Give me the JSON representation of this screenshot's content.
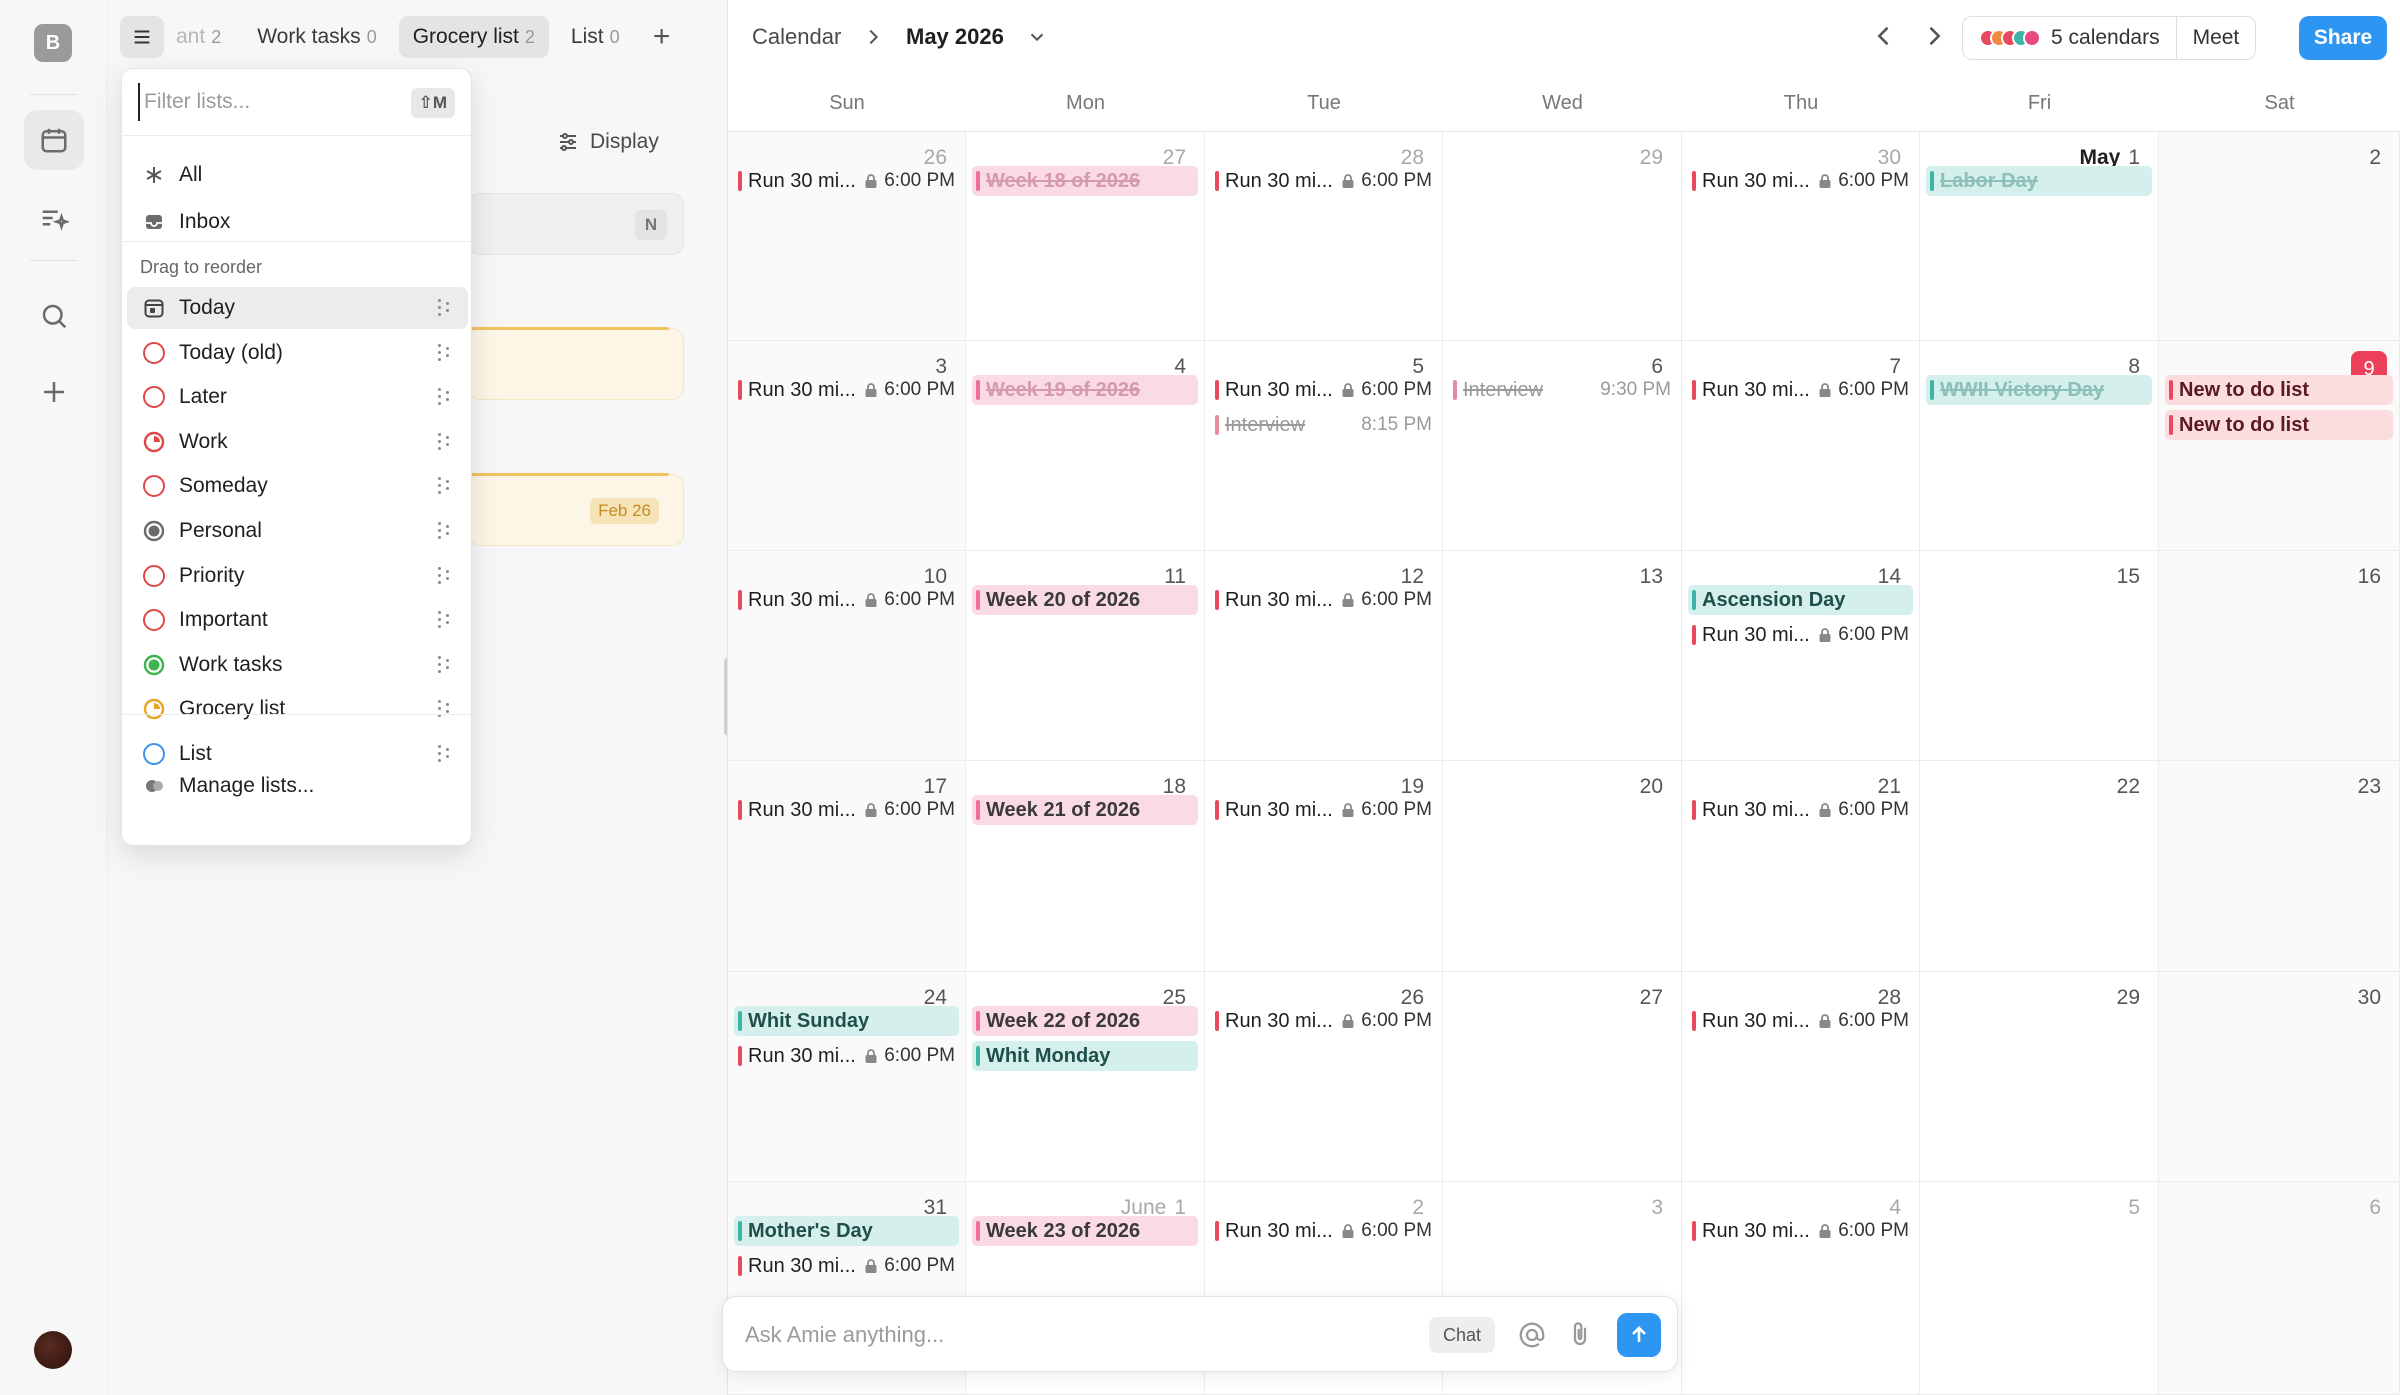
{
  "rail": {
    "workspace_initial": "B",
    "items": [
      {
        "name": "calendar-icon"
      },
      {
        "name": "tasks-sparkle-icon"
      },
      {
        "name": "search-icon"
      },
      {
        "name": "plus-icon"
      }
    ]
  },
  "tabs": [
    {
      "label": "ant",
      "count": "2"
    },
    {
      "label": "Work tasks",
      "count": "0"
    },
    {
      "label": "Grocery list",
      "count": "2"
    },
    {
      "label": "List",
      "count": "0"
    }
  ],
  "panel": {
    "display_label": "Display",
    "card_key": "N",
    "card_date": "Feb 26"
  },
  "dropdown": {
    "filter_placeholder": "Filter lists...",
    "filter_shortcut": "⇧M",
    "top_items": [
      {
        "label": "All",
        "icon": "asterisk-icon"
      },
      {
        "label": "Inbox",
        "icon": "inbox-icon"
      }
    ],
    "section_label": "Drag to reorder",
    "lists": [
      {
        "label": "Today",
        "icon": "today-calendar-icon"
      },
      {
        "label": "Today (old)",
        "icon": "ring-icon",
        "color": "#e04848"
      },
      {
        "label": "Later",
        "icon": "ring-icon",
        "color": "#e04848"
      },
      {
        "label": "Work",
        "icon": "pie-ring-icon",
        "color": "#e04848"
      },
      {
        "label": "Someday",
        "icon": "ring-icon",
        "color": "#e04848"
      },
      {
        "label": "Personal",
        "icon": "filled-ring-icon",
        "color": "#6b6b6b"
      },
      {
        "label": "Priority",
        "icon": "ring-icon",
        "color": "#e04848"
      },
      {
        "label": "Important",
        "icon": "ring-icon",
        "color": "#e04848"
      },
      {
        "label": "Work tasks",
        "icon": "filled-ring-icon",
        "color": "#3fb34f"
      },
      {
        "label": "Grocery list",
        "icon": "pie-ring-icon",
        "color": "#e8a526"
      },
      {
        "label": "List",
        "icon": "ring-icon",
        "color": "#3d94e6"
      }
    ],
    "manage_label": "Manage lists..."
  },
  "calendar": {
    "breadcrumb_root": "Calendar",
    "month_title": "May 2026",
    "calendars_label": "5 calendars",
    "calendar_colors": [
      "#e8495f",
      "#f08a3c",
      "#e8495f",
      "#3db5a6",
      "#e8497f"
    ],
    "meet_label": "Meet",
    "share_label": "Share",
    "weekdays": [
      "Sun",
      "Mon",
      "Tue",
      "Wed",
      "Thu",
      "Fri",
      "Sat"
    ],
    "weeks": [
      [
        {
          "num": "26",
          "muted": true,
          "events": [
            {
              "title": "Run 30 mi...",
              "time": "6:00 PM",
              "lock": true
            }
          ]
        },
        {
          "num": "27",
          "muted": true,
          "events": [
            {
              "title": "Week 18 of 2026",
              "style": "pink",
              "struck": true
            }
          ]
        },
        {
          "num": "28",
          "muted": true,
          "events": [
            {
              "title": "Run 30 mi...",
              "time": "6:00 PM",
              "lock": true
            }
          ]
        },
        {
          "num": "29",
          "muted": true,
          "events": []
        },
        {
          "num": "30",
          "muted": true,
          "events": [
            {
              "title": "Run 30 mi...",
              "time": "6:00 PM",
              "lock": true
            }
          ]
        },
        {
          "num": "1",
          "month": "May",
          "events": [
            {
              "title": "Labor Day",
              "style": "teal",
              "struck": true
            }
          ]
        },
        {
          "num": "2",
          "events": []
        }
      ],
      [
        {
          "num": "3",
          "events": [
            {
              "title": "Run 30 mi...",
              "time": "6:00 PM",
              "lock": true
            }
          ]
        },
        {
          "num": "4",
          "events": [
            {
              "title": "Week 19 of 2026",
              "style": "pink",
              "struck": true
            }
          ]
        },
        {
          "num": "5",
          "events": [
            {
              "title": "Run 30 mi...",
              "time": "6:00 PM",
              "lock": true
            },
            {
              "title": "Interview",
              "time": "8:15 PM",
              "struck": true,
              "style": "grey-bar"
            }
          ]
        },
        {
          "num": "6",
          "events": [
            {
              "title": "Interview",
              "time": "9:30 PM",
              "struck": true,
              "style": "grey-bar"
            }
          ]
        },
        {
          "num": "7",
          "events": [
            {
              "title": "Run 30 mi...",
              "time": "6:00 PM",
              "lock": true
            }
          ]
        },
        {
          "num": "8",
          "events": [
            {
              "title": "WWII Victory Day",
              "style": "teal",
              "struck": true
            }
          ]
        },
        {
          "num": "9",
          "today": true,
          "events": [
            {
              "title": "New to do list",
              "style": "red"
            },
            {
              "title": "New to do list",
              "style": "red"
            }
          ]
        }
      ],
      [
        {
          "num": "10",
          "events": [
            {
              "title": "Run 30 mi...",
              "time": "6:00 PM",
              "lock": true
            }
          ]
        },
        {
          "num": "11",
          "events": [
            {
              "title": "Week 20 of 2026",
              "style": "pink"
            }
          ]
        },
        {
          "num": "12",
          "events": [
            {
              "title": "Run 30 mi...",
              "time": "6:00 PM",
              "lock": true
            }
          ]
        },
        {
          "num": "13",
          "events": []
        },
        {
          "num": "14",
          "events": [
            {
              "title": "Ascension Day",
              "style": "teal"
            },
            {
              "title": "Run 30 mi...",
              "time": "6:00 PM",
              "lock": true
            }
          ]
        },
        {
          "num": "15",
          "events": []
        },
        {
          "num": "16",
          "events": []
        }
      ],
      [
        {
          "num": "17",
          "events": [
            {
              "title": "Run 30 mi...",
              "time": "6:00 PM",
              "lock": true
            }
          ]
        },
        {
          "num": "18",
          "events": [
            {
              "title": "Week 21 of 2026",
              "style": "pink"
            }
          ]
        },
        {
          "num": "19",
          "events": [
            {
              "title": "Run 30 mi...",
              "time": "6:00 PM",
              "lock": true
            }
          ]
        },
        {
          "num": "20",
          "events": []
        },
        {
          "num": "21",
          "events": [
            {
              "title": "Run 30 mi...",
              "time": "6:00 PM",
              "lock": true
            }
          ]
        },
        {
          "num": "22",
          "events": []
        },
        {
          "num": "23",
          "events": []
        }
      ],
      [
        {
          "num": "24",
          "events": [
            {
              "title": "Whit Sunday",
              "style": "teal"
            },
            {
              "title": "Run 30 mi...",
              "time": "6:00 PM",
              "lock": true
            }
          ]
        },
        {
          "num": "25",
          "events": [
            {
              "title": "Week 22 of 2026",
              "style": "pink"
            },
            {
              "title": "Whit Monday",
              "style": "teal"
            }
          ]
        },
        {
          "num": "26",
          "events": [
            {
              "title": "Run 30 mi...",
              "time": "6:00 PM",
              "lock": true
            }
          ]
        },
        {
          "num": "27",
          "events": []
        },
        {
          "num": "28",
          "events": [
            {
              "title": "Run 30 mi...",
              "time": "6:00 PM",
              "lock": true
            }
          ]
        },
        {
          "num": "29",
          "events": []
        },
        {
          "num": "30",
          "events": []
        }
      ],
      [
        {
          "num": "31",
          "events": [
            {
              "title": "Mother's Day",
              "style": "teal"
            },
            {
              "title": "Run 30 mi...",
              "time": "6:00 PM",
              "lock": true
            }
          ]
        },
        {
          "num": "1",
          "month": "June",
          "muted": true,
          "events": [
            {
              "title": "Week 23 of 2026",
              "style": "pink"
            }
          ]
        },
        {
          "num": "2",
          "muted": true,
          "events": [
            {
              "title": "Run 30 mi...",
              "time": "6:00 PM",
              "lock": true
            }
          ]
        },
        {
          "num": "3",
          "muted": true,
          "events": []
        },
        {
          "num": "4",
          "muted": true,
          "events": [
            {
              "title": "Run 30 mi...",
              "time": "6:00 PM",
              "lock": true
            }
          ]
        },
        {
          "num": "5",
          "muted": true,
          "events": []
        },
        {
          "num": "6",
          "muted": true,
          "events": []
        }
      ]
    ]
  },
  "ask": {
    "placeholder": "Ask Amie anything...",
    "chat_label": "Chat"
  }
}
